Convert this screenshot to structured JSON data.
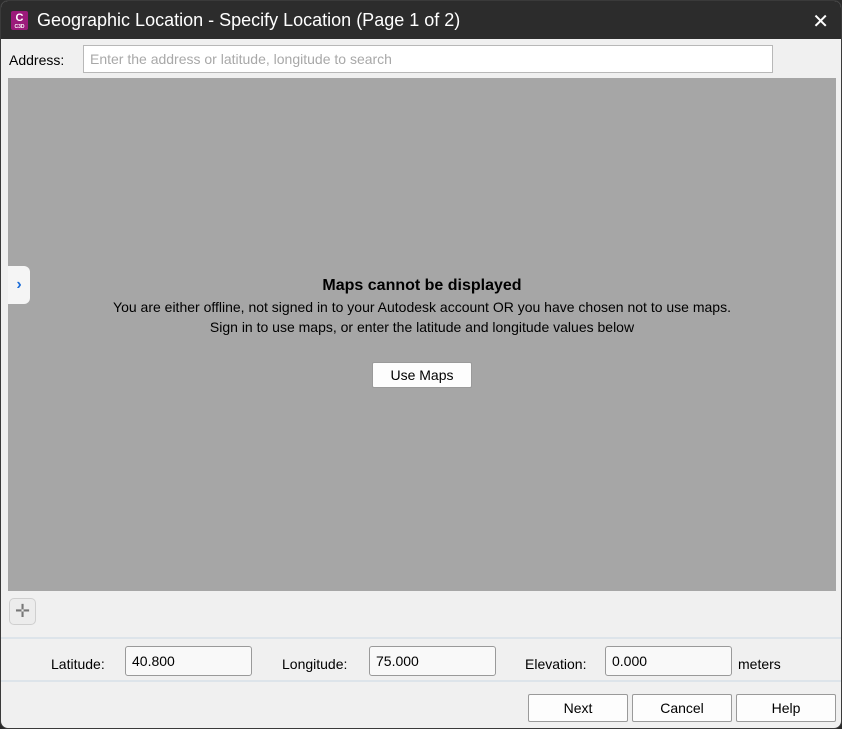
{
  "window": {
    "title": "Geographic Location - Specify Location (Page 1 of 2)",
    "app_icon_letter": "C",
    "app_icon_sub": "C3D"
  },
  "address": {
    "label": "Address:",
    "placeholder": "Enter the address or latitude, longitude to search",
    "value": ""
  },
  "map": {
    "title": "Maps cannot be displayed",
    "line1": "You are either offline, not signed in to your Autodesk account OR you have chosen not to use maps.",
    "line2": "Sign in to use maps, or enter the latitude and longitude values below",
    "use_maps": "Use Maps"
  },
  "coords": {
    "latitude_label": "Latitude:",
    "latitude": "40.800",
    "longitude_label": "Longitude:",
    "longitude": "75.000",
    "elevation_label": "Elevation:",
    "elevation": "0.000",
    "units": "meters"
  },
  "buttons": {
    "next": "Next",
    "cancel": "Cancel",
    "help": "Help"
  }
}
